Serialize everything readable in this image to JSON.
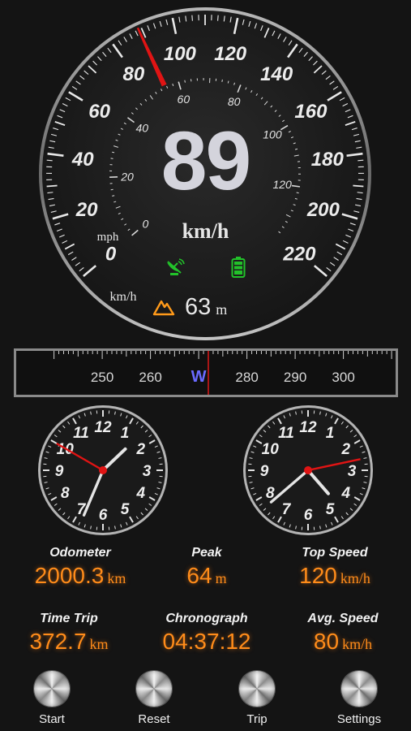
{
  "speedometer": {
    "speed": "89",
    "unit": "km/h",
    "kmh_label": "km/h",
    "mph_label": "mph",
    "kmh_ticks": [
      "0",
      "20",
      "40",
      "60",
      "80",
      "100",
      "120",
      "140",
      "160",
      "180",
      "200",
      "220"
    ],
    "mph_ticks": [
      "0",
      "20",
      "40",
      "60",
      "80",
      "100",
      "120"
    ],
    "kmh_max": 220,
    "mph_max": 137,
    "needle_speed_kmh": 89
  },
  "status": {
    "gps_icon": "satellite-dish-icon",
    "battery_icon": "battery-icon",
    "altitude_icon": "mountain-icon",
    "altitude_value": "63",
    "altitude_unit": "m",
    "accent_green": "#22c22a",
    "accent_orange": "#ff9a1a"
  },
  "compass": {
    "labels": [
      "250",
      "260",
      "W",
      "280",
      "290",
      "300"
    ],
    "heading_deg": 272,
    "direction": "W"
  },
  "clocks": [
    {
      "hour": 1,
      "minute": 33,
      "second": 50
    },
    {
      "hour": 4,
      "minute": 38,
      "second": 13
    }
  ],
  "clock_numerals": [
    "12",
    "1",
    "2",
    "3",
    "4",
    "5",
    "6",
    "7",
    "8",
    "9",
    "10",
    "11"
  ],
  "stats": {
    "odometer": {
      "label": "Odometer",
      "value": "2000.3",
      "unit": "km"
    },
    "peak": {
      "label": "Peak",
      "value": "64",
      "unit": "m"
    },
    "top_speed": {
      "label": "Top Speed",
      "value": "120",
      "unit": "km/h"
    },
    "time_trip": {
      "label": "Time Trip",
      "value": "372.7",
      "unit": "km"
    },
    "chronograph": {
      "label": "Chronograph",
      "value": "04:37:12"
    },
    "avg_speed": {
      "label": "Avg. Speed",
      "value": "80",
      "unit": "km/h"
    }
  },
  "buttons": {
    "start": "Start",
    "reset": "Reset",
    "trip": "Trip",
    "settings": "Settings"
  },
  "colors": {
    "needle": "#e01414",
    "value_orange": "#ff8c1a",
    "compass_w": "#6a6aff"
  }
}
